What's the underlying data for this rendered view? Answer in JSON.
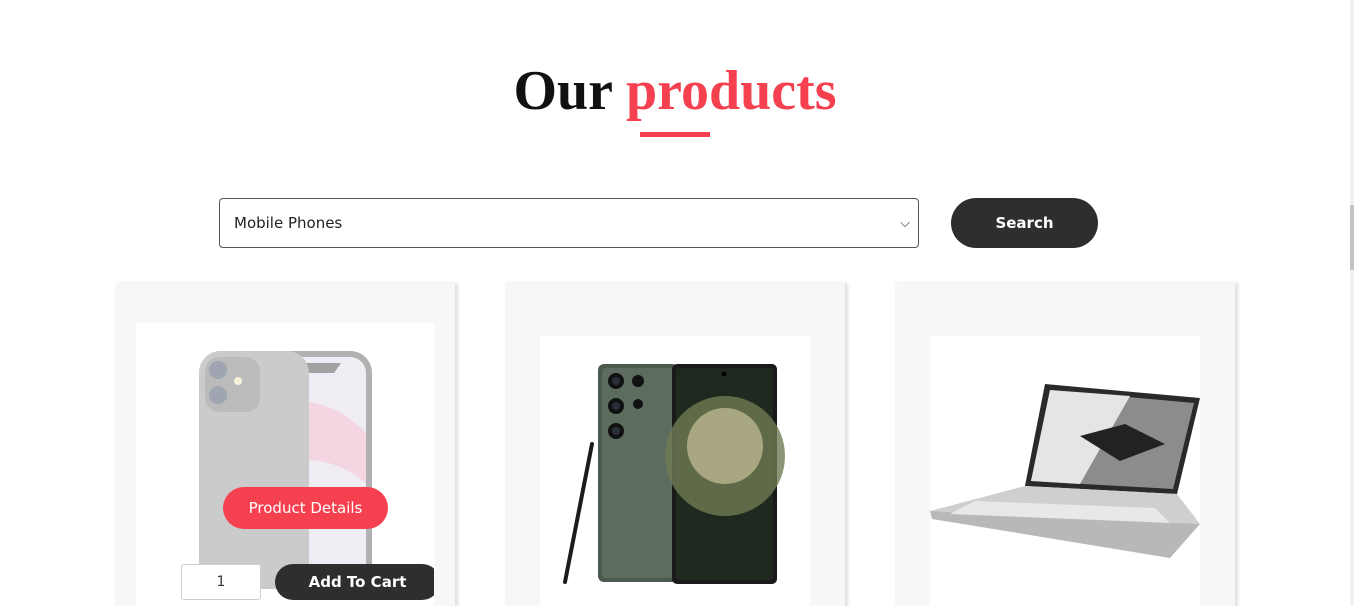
{
  "section": {
    "title_plain": "Our",
    "title_accent": "products"
  },
  "filter": {
    "selected_category": "Mobile Phones",
    "search_label": "Search"
  },
  "products": [
    {
      "image": "iphone-11-icon",
      "details_label": "Product Details",
      "quantity": "1",
      "add_to_cart_label": "Add To Cart",
      "hovered": true
    },
    {
      "image": "samsung-galaxy-s23-ultra-icon"
    },
    {
      "image": "asus-rog-zephyrus-laptop-icon"
    }
  ],
  "colors": {
    "accent": "#f4404f",
    "dark_button": "#2e2e2e",
    "card_bg": "#f7f7f8"
  }
}
